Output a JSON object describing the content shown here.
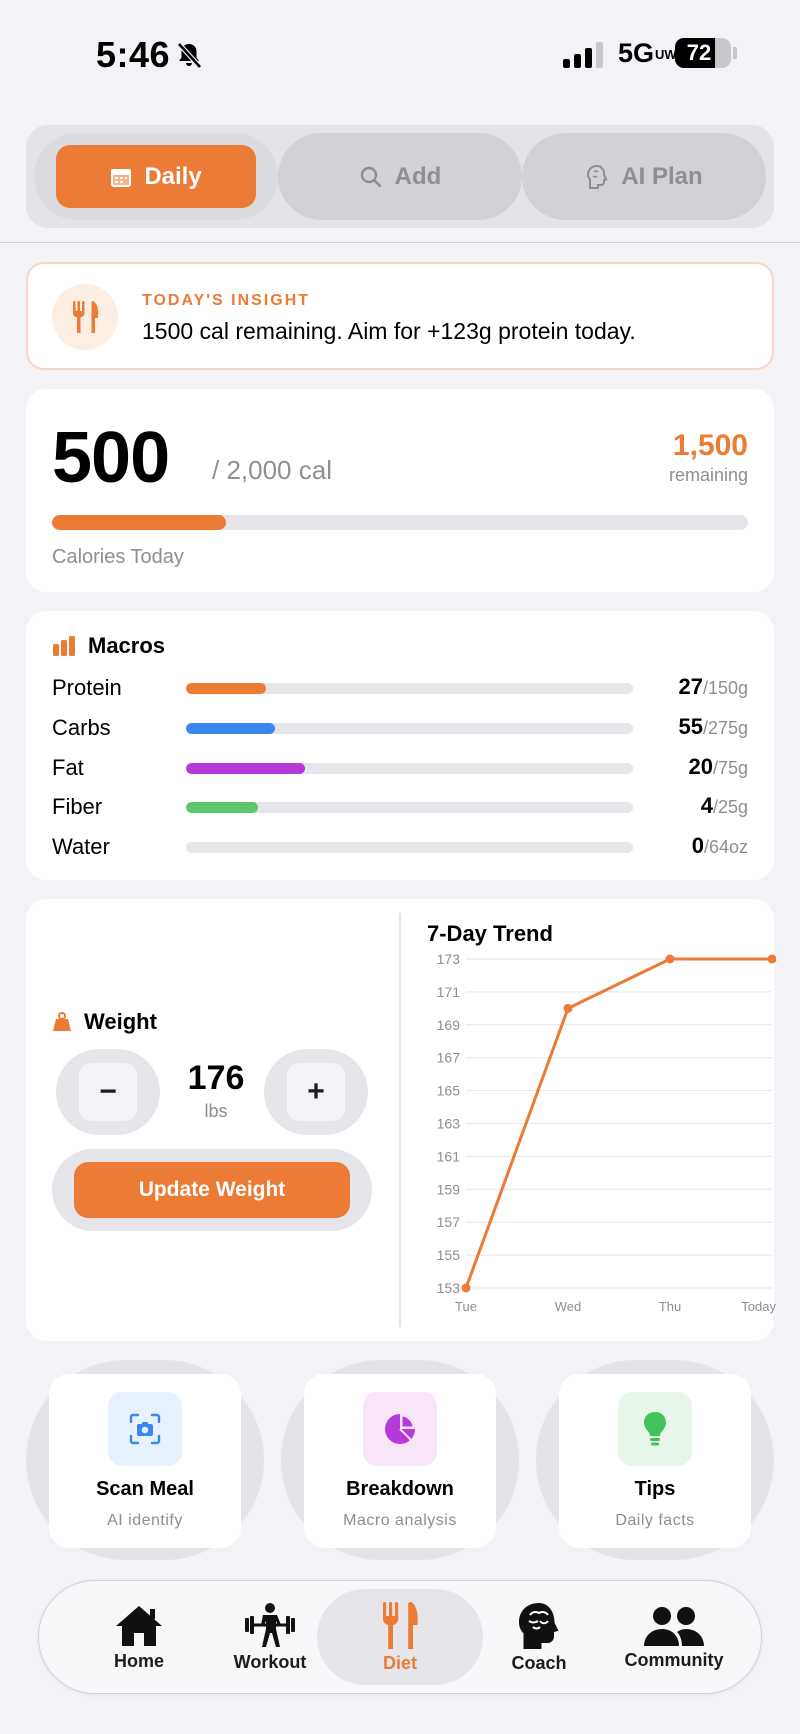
{
  "status_bar": {
    "time": "5:46",
    "network": "5G",
    "network_sub": "UW",
    "battery": "72"
  },
  "segments": [
    {
      "label": "Daily",
      "icon": "calendar-icon",
      "active": true
    },
    {
      "label": "Add",
      "icon": "search-icon",
      "active": false
    },
    {
      "label": "AI Plan",
      "icon": "brain-icon",
      "active": false
    }
  ],
  "insight": {
    "label": "TODAY'S INSIGHT",
    "text": "1500 cal remaining. Aim for +123g protein today.",
    "icon": "fork-knife-icon"
  },
  "calories": {
    "consumed": "500",
    "goal_text": "/ 2,000 cal",
    "remaining": "1,500",
    "remaining_label": "remaining",
    "progress": 0.25,
    "label": "Calories Today",
    "accent": "#ec7b35"
  },
  "macros": {
    "title": "Macros",
    "items": [
      {
        "name": "Protein",
        "value": "27",
        "unit": "/150g",
        "progress": 0.18,
        "color": "#ec7b35"
      },
      {
        "name": "Carbs",
        "value": "55",
        "unit": "/275g",
        "progress": 0.2,
        "color": "#3a86f0"
      },
      {
        "name": "Fat",
        "value": "20",
        "unit": "/75g",
        "progress": 0.267,
        "color": "#b53ad9"
      },
      {
        "name": "Fiber",
        "value": "4",
        "unit": "/25g",
        "progress": 0.16,
        "color": "#5ec66a"
      },
      {
        "name": "Water",
        "value": "0",
        "unit": "/64oz",
        "progress": 0,
        "color": "#4aa8e8"
      }
    ]
  },
  "weight": {
    "title": "Weight",
    "value": "176",
    "unit": "lbs",
    "minus_label": "−",
    "plus_label": "+",
    "update_label": "Update Weight"
  },
  "trend": {
    "title": "7-Day Trend"
  },
  "chart_data": {
    "type": "line",
    "title": "7-Day Trend",
    "categories": [
      "Tue",
      "Wed",
      "Thu",
      "Today"
    ],
    "series": [
      {
        "values": [
          153,
          170,
          173,
          173
        ]
      }
    ],
    "ylim": [
      153,
      173
    ],
    "yticks": [
      "173",
      "171",
      "169",
      "167",
      "165",
      "163",
      "161",
      "159",
      "157",
      "155",
      "153"
    ],
    "grid": true,
    "color": "#ec7b35"
  },
  "quick_actions": [
    {
      "title": "Scan Meal",
      "subtitle": "AI identify",
      "icon": "camera-scan-icon",
      "bg": "#e6f1fd"
    },
    {
      "title": "Breakdown",
      "subtitle": "Macro analysis",
      "icon": "pie-chart-icon",
      "bg": "#f8e6f8"
    },
    {
      "title": "Tips",
      "subtitle": "Daily facts",
      "icon": "lightbulb-icon",
      "bg": "#e7f6e9"
    }
  ],
  "tabs": [
    {
      "label": "Home",
      "icon": "home-icon",
      "active": false
    },
    {
      "label": "Workout",
      "icon": "workout-icon",
      "active": false
    },
    {
      "label": "Diet",
      "icon": "fork-knife-icon",
      "active": true
    },
    {
      "label": "Coach",
      "icon": "brain-head-icon",
      "active": false
    },
    {
      "label": "Community",
      "icon": "people-icon",
      "active": false
    }
  ]
}
